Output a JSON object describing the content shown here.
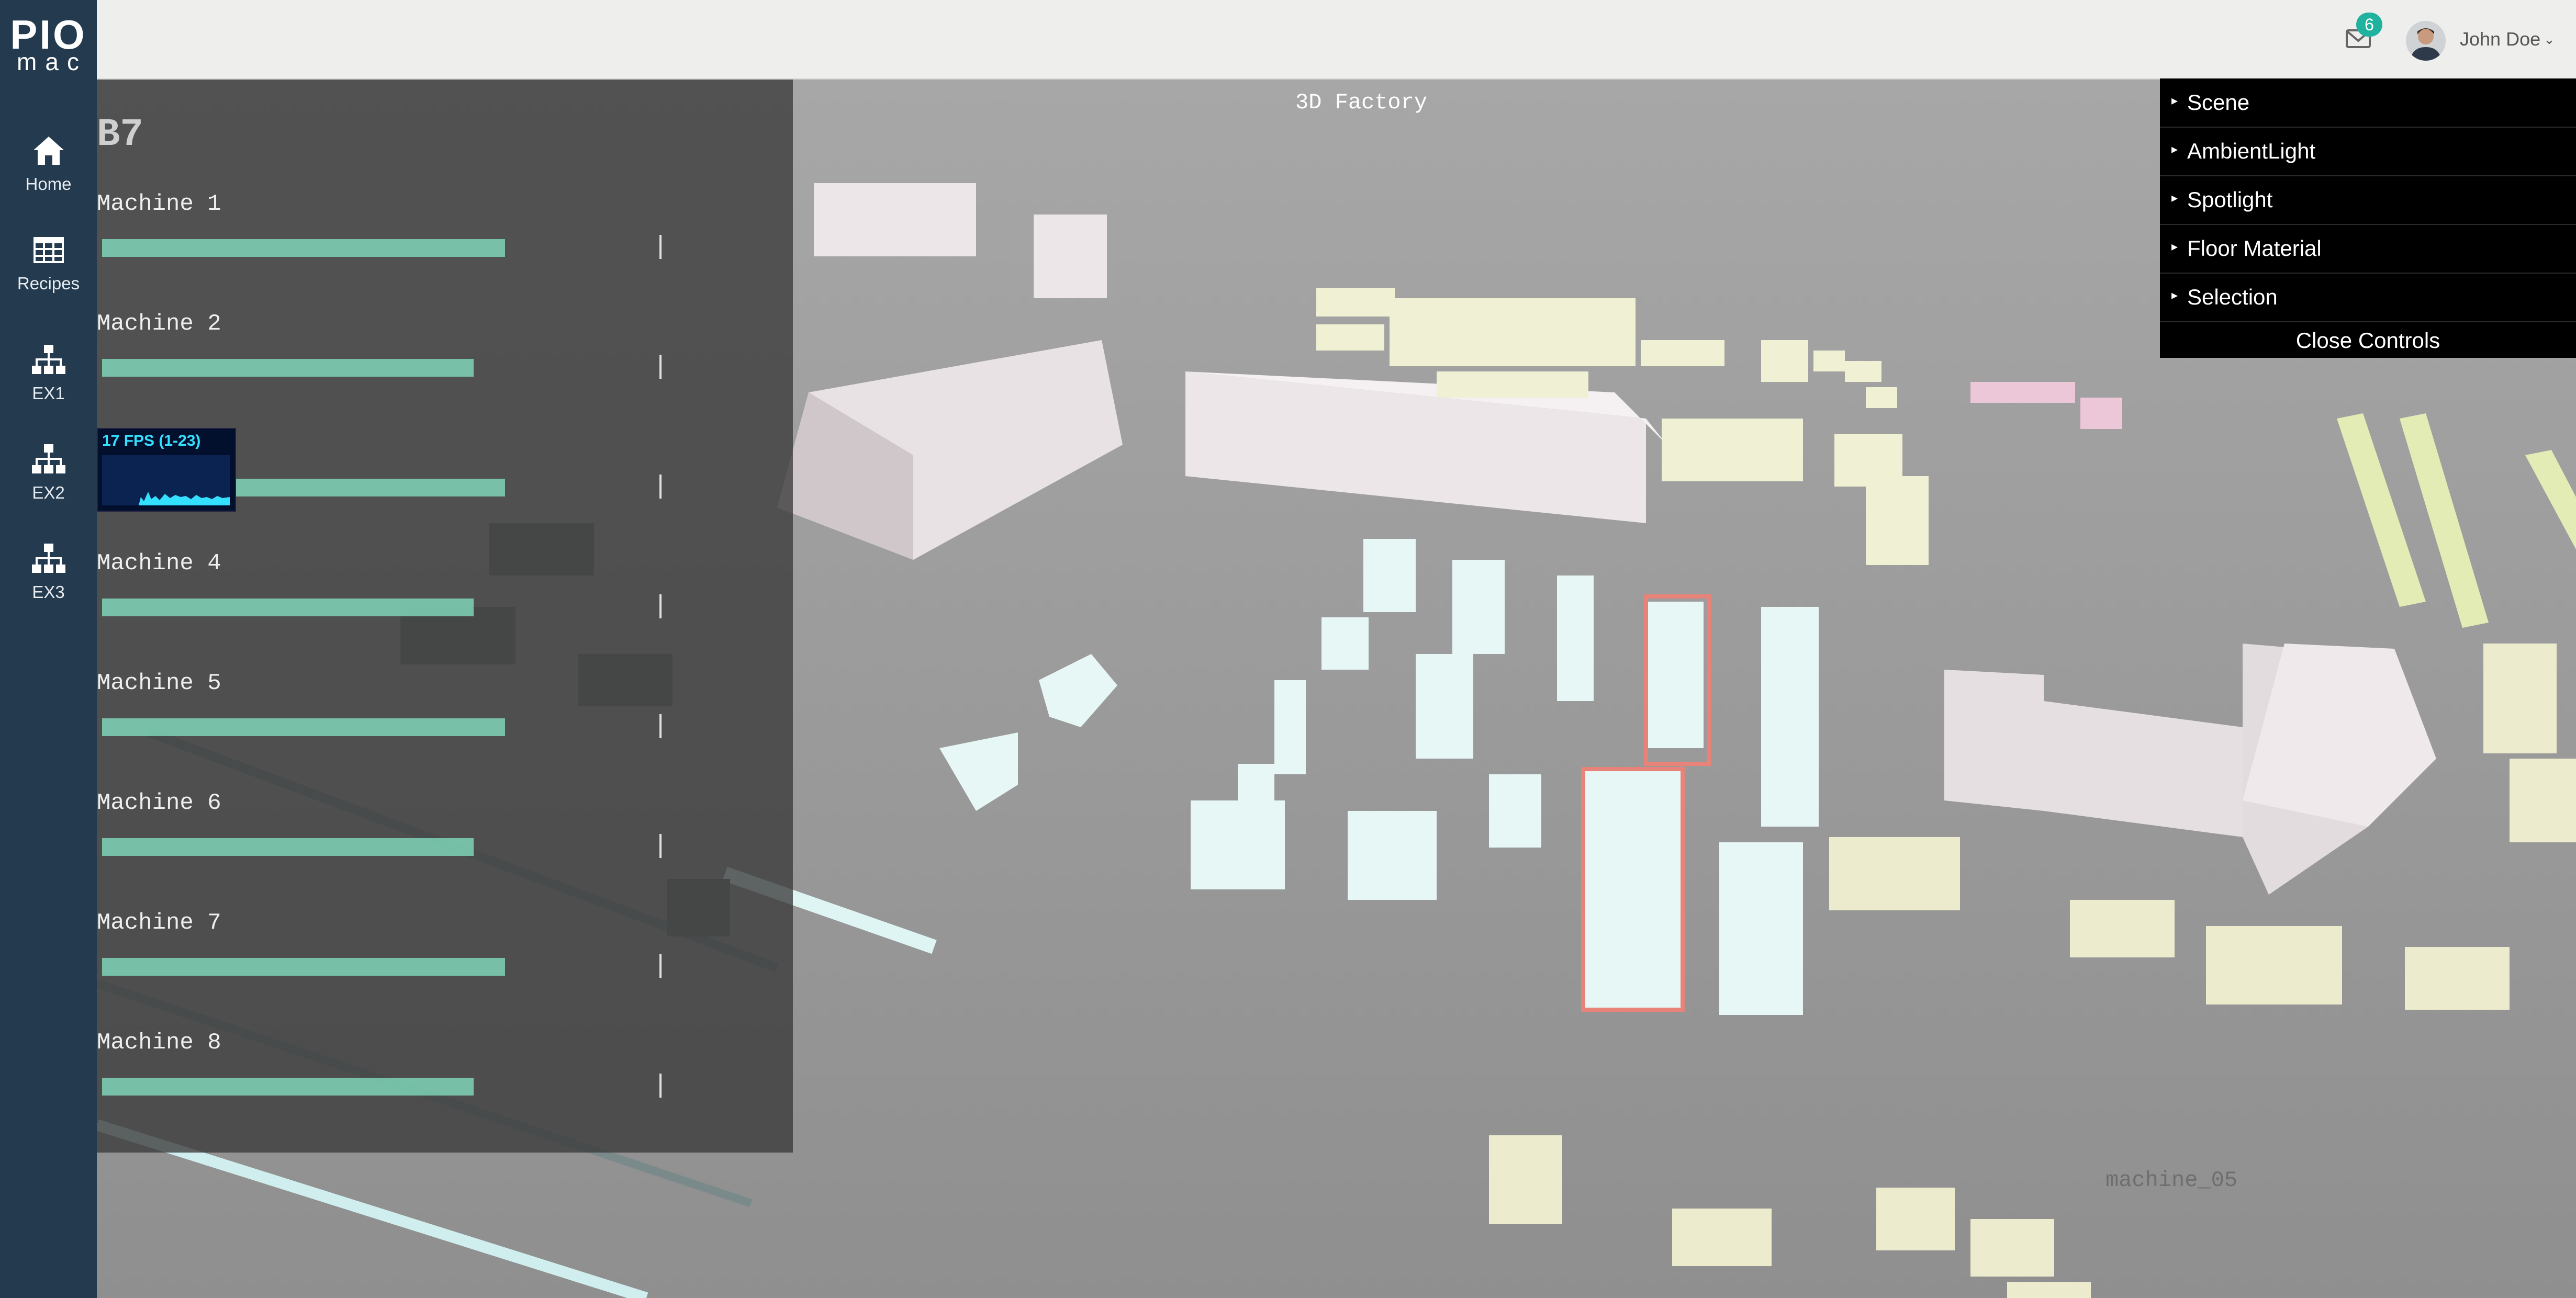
{
  "logo": {
    "line1": "PIO",
    "line2": "mac"
  },
  "sidebar": {
    "items": [
      {
        "label": "Home",
        "icon": "home-icon"
      },
      {
        "label": "Recipes",
        "icon": "table-icon"
      },
      {
        "label": "EX1",
        "icon": "sitemap-icon"
      },
      {
        "label": "EX2",
        "icon": "sitemap-icon"
      },
      {
        "label": "EX3",
        "icon": "sitemap-icon"
      }
    ]
  },
  "header": {
    "mail_icon": "envelope-icon",
    "mail_count": "6",
    "user_name": "John Doe",
    "user_caret": "⌄"
  },
  "scene": {
    "title": "3D Factory",
    "hover_label": "machine_05"
  },
  "panel": {
    "title": "B7",
    "machines": [
      {
        "label": "Machine 1",
        "level": 0.77
      },
      {
        "label": "Machine 2",
        "level": 0.71
      },
      {
        "label": "",
        "level": 0.77
      },
      {
        "label": "Machine 4",
        "level": 0.71
      },
      {
        "label": "Machine 5",
        "level": 0.77
      },
      {
        "label": "Machine 6",
        "level": 0.71
      },
      {
        "label": "Machine 7",
        "level": 0.77
      },
      {
        "label": "Machine 8",
        "level": 0.71
      }
    ]
  },
  "fps": {
    "label": "17 FPS (1-23)"
  },
  "controls": {
    "items": [
      "Scene",
      "AmbientLight",
      "Spotlight",
      "Floor Material",
      "Selection"
    ],
    "close_label": "Close Controls"
  },
  "colors": {
    "sidebar": "#243a4e",
    "topbar": "#eeeeec",
    "badge": "#1fb29f",
    "bar": "#7fd3b7",
    "floor": "#9c9c9c",
    "selection_outline": "#e8837a"
  }
}
